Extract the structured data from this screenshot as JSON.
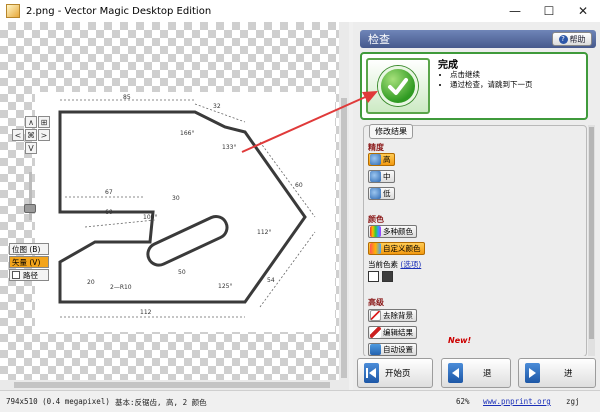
{
  "window": {
    "title": "2.png - Vector Magic Desktop Edition",
    "min_symbol": "—",
    "max_symbol": "☐",
    "close_symbol": "✕"
  },
  "canvas": {
    "nav_up": "∧",
    "nav_left": "<",
    "nav_right": ">",
    "nav_down": "V",
    "nav_center": "⌘",
    "view_buttons": [
      {
        "label": "位图  (B)"
      },
      {
        "label": "矢量  (V)"
      },
      {
        "label": "路径"
      }
    ]
  },
  "drawing": {
    "dims": [
      "85",
      "32",
      "166°",
      "133°",
      "67",
      "60",
      "109°",
      "30",
      "60",
      "112°",
      "50",
      "20",
      "2—R10",
      "125°",
      "54",
      "112"
    ]
  },
  "panel": {
    "header": "检查",
    "help_label": "帮助",
    "result_title": "完成",
    "result_items": [
      "点击继续",
      "通过检查，请跳到下一页"
    ],
    "modify_tab": "修改结果",
    "precision_label": "精度",
    "precision_options": [
      "高",
      "中",
      "低"
    ],
    "color_label": "颜色",
    "color_options": [
      "多种颜色",
      "自定义颜色"
    ],
    "current_colors_label": "当前色素",
    "current_colors_link": "(选项)",
    "advanced_label": "高级",
    "advanced_options": [
      "去除背景",
      "编辑结果",
      "自动设置"
    ],
    "new_tag": "New!"
  },
  "nav": {
    "start": "开始页",
    "back": "退",
    "forward": "进"
  },
  "status": {
    "dims": "794x510 (0.4 megapixel)",
    "info": "基本:反锯齿, 高, 2 颜色",
    "zoom": "62%",
    "url": "www.pnprint.org",
    "user": "zgj"
  },
  "colors": {
    "accent": "#4c5f93",
    "success": "#3f9a3b",
    "selected": "#f39a10",
    "arrow": "#e03a3a"
  }
}
